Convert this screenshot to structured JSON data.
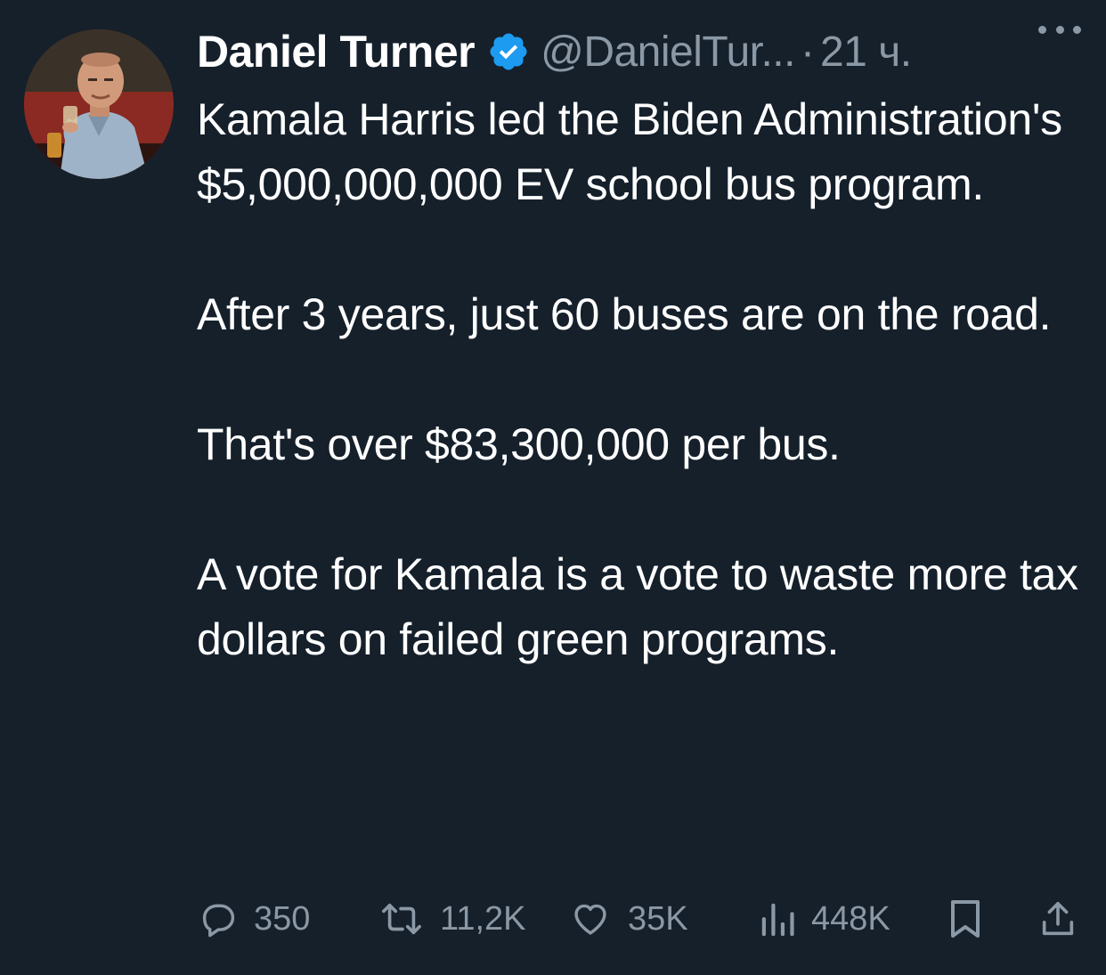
{
  "tweet": {
    "author": {
      "display_name": "Daniel Turner",
      "verified": true,
      "handle": "@DanielTur...",
      "separator": "·",
      "time": "21 ч."
    },
    "text_paragraphs": [
      "Kamala Harris led the Biden Administration's $5,000,000,000 EV school bus program.",
      "After 3 years, just 60 buses are on the road.",
      "That's over $83,300,000 per bus.",
      "A vote for Kamala is a vote to waste more tax dollars on failed green programs."
    ],
    "actions": {
      "replies": "350",
      "reposts": "11,2K",
      "likes": "35K",
      "views": "448K"
    }
  },
  "icons": {
    "verified": "verified-badge-icon",
    "more": "more-options-icon",
    "reply": "reply-bubble-icon",
    "repost": "repost-icon",
    "like": "heart-icon",
    "views": "bar-chart-icon",
    "bookmark": "bookmark-icon",
    "share": "share-icon"
  },
  "colors": {
    "background": "#15202b",
    "text": "#ffffff",
    "secondary": "#8b98a5",
    "verified": "#1d9bf0"
  }
}
